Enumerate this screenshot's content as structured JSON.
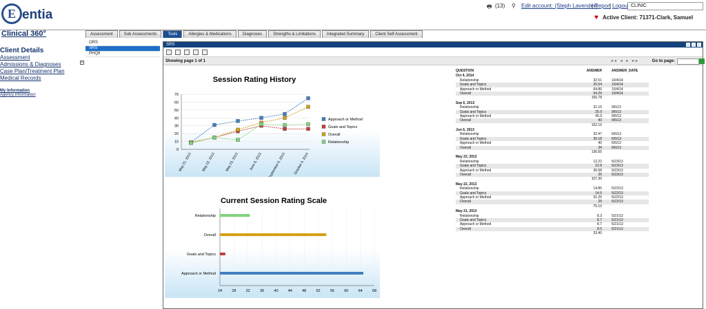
{
  "app": {
    "logo_letter": "E",
    "logo_text": "entia",
    "module_title": "Clinical 360°"
  },
  "utility": {
    "count": "(13)",
    "account": "Edit account: (Steph Lavender)",
    "report": "Report",
    "logout": "Logout",
    "clinic": "CLINIC"
  },
  "active_client": "Active Client: 71371-Clark, Samuel",
  "tabs": [
    "Assessment",
    "Sub Assessments",
    "Tools",
    "Allergies & Medications",
    "Diagnoses",
    "Strengths & Limitations",
    "Integrated Summary",
    "Client Self Assessment"
  ],
  "active_tab": 2,
  "sublist": [
    "ORS",
    "SRS",
    "PHQ9"
  ],
  "sublist_selected": 1,
  "left_nav": {
    "title": "Client Details",
    "items": [
      "Assessment",
      "Admissions & Diagnoses",
      "Case Plan/Treatment Plan",
      "Medical Records"
    ],
    "section": "My Information",
    "section_item": "Agency Information"
  },
  "panel": {
    "title": "SRS",
    "showing": "Showing page  1  of  1",
    "goto": "Go to page:"
  },
  "colors": {
    "approach": "#3f7fbf",
    "goals": "#c23b3b",
    "overall": "#d4a017",
    "relationship": "#7fd37f",
    "header_blue": "#14427d"
  },
  "table": {
    "headers": {
      "question": "QUESTION",
      "answer": "ANSWER",
      "date": "ANSWER_DATE"
    },
    "groups": [
      {
        "date": "Oct 4, 2014",
        "rows": [
          [
            "Relationship",
            "32.51",
            "10/4/14"
          ],
          [
            "Goals and Topics",
            "25.54",
            "10/4/14"
          ],
          [
            "Approach or Method",
            "64.86",
            "10/4/14"
          ],
          [
            "Overall",
            "54.29",
            "10/4/14"
          ]
        ],
        "total": "156.78"
      },
      {
        "date": "Sep 6, 2013",
        "rows": [
          [
            "Relationship",
            "31.15",
            "9/6/13"
          ],
          [
            "Goals and Topics",
            "25.9",
            "9/6/13"
          ],
          [
            "Approach or Method",
            "45.9",
            "9/6/13"
          ],
          [
            "Overall",
            "40",
            "9/6/13"
          ]
        ],
        "total": "152.15"
      },
      {
        "date": "Jun 6, 2013",
        "rows": [
          [
            "Relationship",
            "32.47",
            "6/6/13"
          ],
          [
            "Goals and Topics",
            "30.18",
            "6/6/13"
          ],
          [
            "Approach or Method",
            "40",
            "6/6/13"
          ],
          [
            "Overall",
            "34",
            "6/6/13"
          ]
        ],
        "total": "136.65"
      },
      {
        "date": "May 23, 2013",
        "rows": [
          [
            "Relationship",
            "12.22",
            "5/23/13"
          ],
          [
            "Goals and Topics",
            "22.8",
            "5/23/13"
          ],
          [
            "Approach or Method",
            "36.58",
            "5/23/13"
          ],
          [
            "Overall",
            "25",
            "5/23/13"
          ]
        ],
        "total": "107.30"
      },
      {
        "date": "May 22, 2013",
        "rows": [
          [
            "Relationship",
            "14.85",
            "5/22/13"
          ],
          [
            "Goals and Topics",
            "14.5",
            "5/22/13"
          ],
          [
            "Approach or Method",
            "31.25",
            "5/22/13"
          ],
          [
            "Overall",
            "25",
            "5/22/13"
          ]
        ],
        "total": "75.10"
      },
      {
        "date": "May 21, 2013",
        "rows": [
          [
            "Relationship",
            "8.3",
            "5/21/13"
          ],
          [
            "Goals and Topics",
            "8.7",
            "5/21/13"
          ],
          [
            "Approach or Method",
            "8.7",
            "5/21/13"
          ],
          [
            "Overall",
            "8.5",
            "5/21/13"
          ]
        ],
        "total": "33.40"
      }
    ]
  },
  "chart_data": [
    {
      "type": "line",
      "title": "Session Rating History",
      "categories": [
        "May 21, 2013",
        "May 22, 2013",
        "May 23, 2013",
        "June 6, 2013",
        "September 6, 2013",
        "October 4, 2014"
      ],
      "ylim": [
        0,
        70
      ],
      "yticks": [
        0,
        10,
        20,
        30,
        40,
        50,
        60,
        70
      ],
      "series": [
        {
          "name": "Approach or Method",
          "values": [
            9,
            31,
            36,
            40,
            45,
            65
          ]
        },
        {
          "name": "Goals and Topics",
          "values": [
            9,
            15,
            23,
            30,
            26,
            26
          ]
        },
        {
          "name": "Overall",
          "values": [
            9,
            15,
            25,
            34,
            40,
            54
          ]
        },
        {
          "name": "Relationship",
          "values": [
            8,
            15,
            12,
            32,
            31,
            32
          ]
        }
      ],
      "legend": "right"
    },
    {
      "type": "bar",
      "orientation": "horizontal",
      "title": "Current Session Rating Scale",
      "categories": [
        "Relationship",
        "Overall",
        "Goals and Topics",
        "Approach or Method"
      ],
      "values": [
        32.51,
        54.29,
        25.54,
        64.86
      ],
      "xlim": [
        24,
        68
      ],
      "xticks": [
        24,
        28,
        32,
        36,
        40,
        44,
        48,
        52,
        56,
        60,
        64,
        68
      ]
    }
  ]
}
